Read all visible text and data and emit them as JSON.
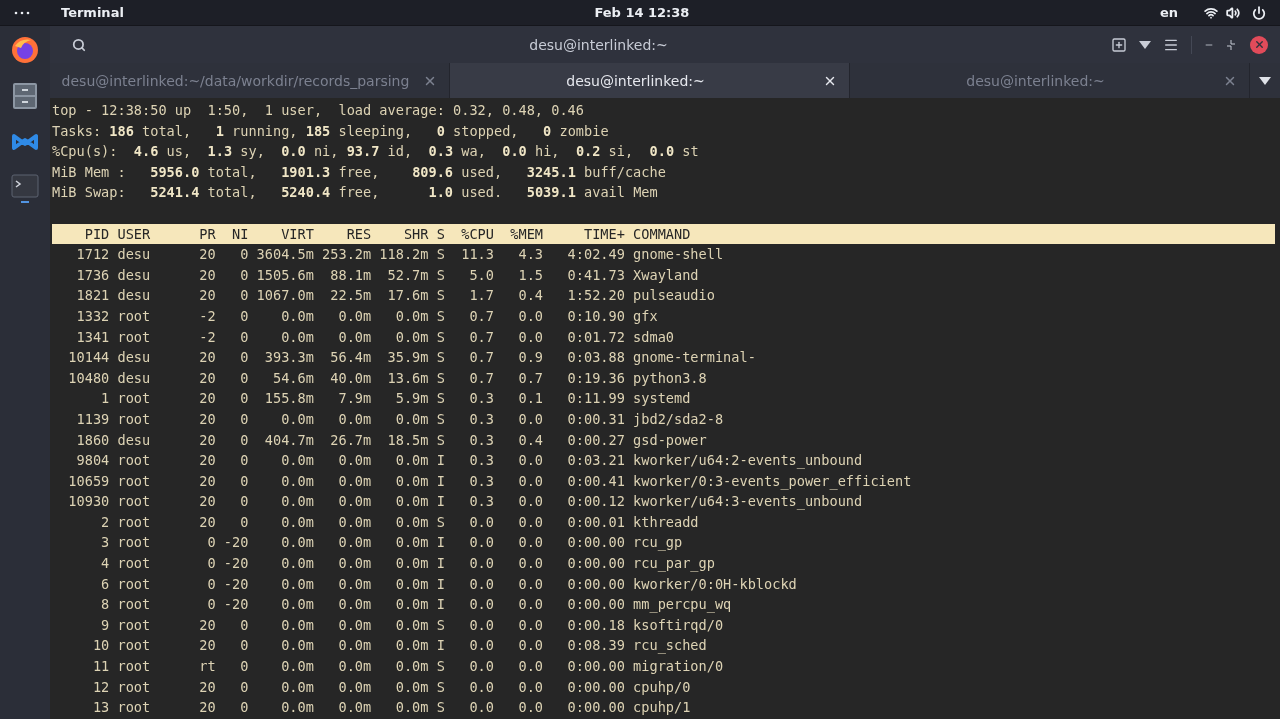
{
  "top_bar": {
    "app_name": "Terminal",
    "clock": "Feb 14  12:38",
    "language": "en"
  },
  "dock": {
    "items": [
      {
        "kind": "browser",
        "running": false
      },
      {
        "kind": "files",
        "running": false
      },
      {
        "kind": "editor",
        "running": false
      },
      {
        "kind": "terminal",
        "running": true
      }
    ]
  },
  "window": {
    "title": "desu@interlinked:~"
  },
  "tabs": [
    {
      "label": "desu@interlinked:~/data/workdir/records_parsing",
      "selected": false
    },
    {
      "label": "desu@interlinked:~",
      "selected": true
    },
    {
      "label": "desu@interlinked:~",
      "selected": false
    }
  ],
  "terminal": {
    "summary": [
      "top - 12:38:50 up  1:50,  1 user,  load average: 0.32, 0.48, 0.46",
      "Tasks: **186** total,   **1** running, **185** sleeping,   **0** stopped,   **0** zombie",
      "%Cpu(s):  **4.6** us,  **1.3** sy,  **0.0** ni, **93.7** id,  **0.3** wa,  **0.0** hi,  **0.2** si,  **0.0** st",
      "MiB Mem :   **5956.0** total,   **1901.3** free,    **809.6** used,   **3245.1** buff/cache",
      "MiB Swap:   **5241.4** total,   **5240.4** free,      **1.0** used.   **5039.1** avail Mem"
    ],
    "columns": [
      "PID",
      "USER",
      "PR",
      "NI",
      "VIRT",
      "RES",
      "SHR",
      "S",
      "%CPU",
      "%MEM",
      "TIME+",
      "COMMAND"
    ],
    "rows": [
      [
        "1712",
        "desu",
        "20",
        "0",
        "3604.5m",
        "253.2m",
        "118.2m",
        "S",
        "11.3",
        "4.3",
        "4:02.49",
        "gnome-shell"
      ],
      [
        "1736",
        "desu",
        "20",
        "0",
        "1505.6m",
        "88.1m",
        "52.7m",
        "S",
        "5.0",
        "1.5",
        "0:41.73",
        "Xwayland"
      ],
      [
        "1821",
        "desu",
        "20",
        "0",
        "1067.0m",
        "22.5m",
        "17.6m",
        "S",
        "1.7",
        "0.4",
        "1:52.20",
        "pulseaudio"
      ],
      [
        "1332",
        "root",
        "-2",
        "0",
        "0.0m",
        "0.0m",
        "0.0m",
        "S",
        "0.7",
        "0.0",
        "0:10.90",
        "gfx"
      ],
      [
        "1341",
        "root",
        "-2",
        "0",
        "0.0m",
        "0.0m",
        "0.0m",
        "S",
        "0.7",
        "0.0",
        "0:01.72",
        "sdma0"
      ],
      [
        "10144",
        "desu",
        "20",
        "0",
        "393.3m",
        "56.4m",
        "35.9m",
        "S",
        "0.7",
        "0.9",
        "0:03.88",
        "gnome-terminal-"
      ],
      [
        "10480",
        "desu",
        "20",
        "0",
        "54.6m",
        "40.0m",
        "13.6m",
        "S",
        "0.7",
        "0.7",
        "0:19.36",
        "python3.8"
      ],
      [
        "1",
        "root",
        "20",
        "0",
        "155.8m",
        "7.9m",
        "5.9m",
        "S",
        "0.3",
        "0.1",
        "0:11.99",
        "systemd"
      ],
      [
        "1139",
        "root",
        "20",
        "0",
        "0.0m",
        "0.0m",
        "0.0m",
        "S",
        "0.3",
        "0.0",
        "0:00.31",
        "jbd2/sda2-8"
      ],
      [
        "1860",
        "desu",
        "20",
        "0",
        "404.7m",
        "26.7m",
        "18.5m",
        "S",
        "0.3",
        "0.4",
        "0:00.27",
        "gsd-power"
      ],
      [
        "9804",
        "root",
        "20",
        "0",
        "0.0m",
        "0.0m",
        "0.0m",
        "I",
        "0.3",
        "0.0",
        "0:03.21",
        "kworker/u64:2-events_unbound"
      ],
      [
        "10659",
        "root",
        "20",
        "0",
        "0.0m",
        "0.0m",
        "0.0m",
        "I",
        "0.3",
        "0.0",
        "0:00.41",
        "kworker/0:3-events_power_efficient"
      ],
      [
        "10930",
        "root",
        "20",
        "0",
        "0.0m",
        "0.0m",
        "0.0m",
        "I",
        "0.3",
        "0.0",
        "0:00.12",
        "kworker/u64:3-events_unbound"
      ],
      [
        "2",
        "root",
        "20",
        "0",
        "0.0m",
        "0.0m",
        "0.0m",
        "S",
        "0.0",
        "0.0",
        "0:00.01",
        "kthreadd"
      ],
      [
        "3",
        "root",
        "0",
        "-20",
        "0.0m",
        "0.0m",
        "0.0m",
        "I",
        "0.0",
        "0.0",
        "0:00.00",
        "rcu_gp"
      ],
      [
        "4",
        "root",
        "0",
        "-20",
        "0.0m",
        "0.0m",
        "0.0m",
        "I",
        "0.0",
        "0.0",
        "0:00.00",
        "rcu_par_gp"
      ],
      [
        "6",
        "root",
        "0",
        "-20",
        "0.0m",
        "0.0m",
        "0.0m",
        "I",
        "0.0",
        "0.0",
        "0:00.00",
        "kworker/0:0H-kblockd"
      ],
      [
        "8",
        "root",
        "0",
        "-20",
        "0.0m",
        "0.0m",
        "0.0m",
        "I",
        "0.0",
        "0.0",
        "0:00.00",
        "mm_percpu_wq"
      ],
      [
        "9",
        "root",
        "20",
        "0",
        "0.0m",
        "0.0m",
        "0.0m",
        "S",
        "0.0",
        "0.0",
        "0:00.18",
        "ksoftirqd/0"
      ],
      [
        "10",
        "root",
        "20",
        "0",
        "0.0m",
        "0.0m",
        "0.0m",
        "I",
        "0.0",
        "0.0",
        "0:08.39",
        "rcu_sched"
      ],
      [
        "11",
        "root",
        "rt",
        "0",
        "0.0m",
        "0.0m",
        "0.0m",
        "S",
        "0.0",
        "0.0",
        "0:00.00",
        "migration/0"
      ],
      [
        "12",
        "root",
        "20",
        "0",
        "0.0m",
        "0.0m",
        "0.0m",
        "S",
        "0.0",
        "0.0",
        "0:00.00",
        "cpuhp/0"
      ],
      [
        "13",
        "root",
        "20",
        "0",
        "0.0m",
        "0.0m",
        "0.0m",
        "S",
        "0.0",
        "0.0",
        "0:00.00",
        "cpuhp/1"
      ]
    ]
  }
}
